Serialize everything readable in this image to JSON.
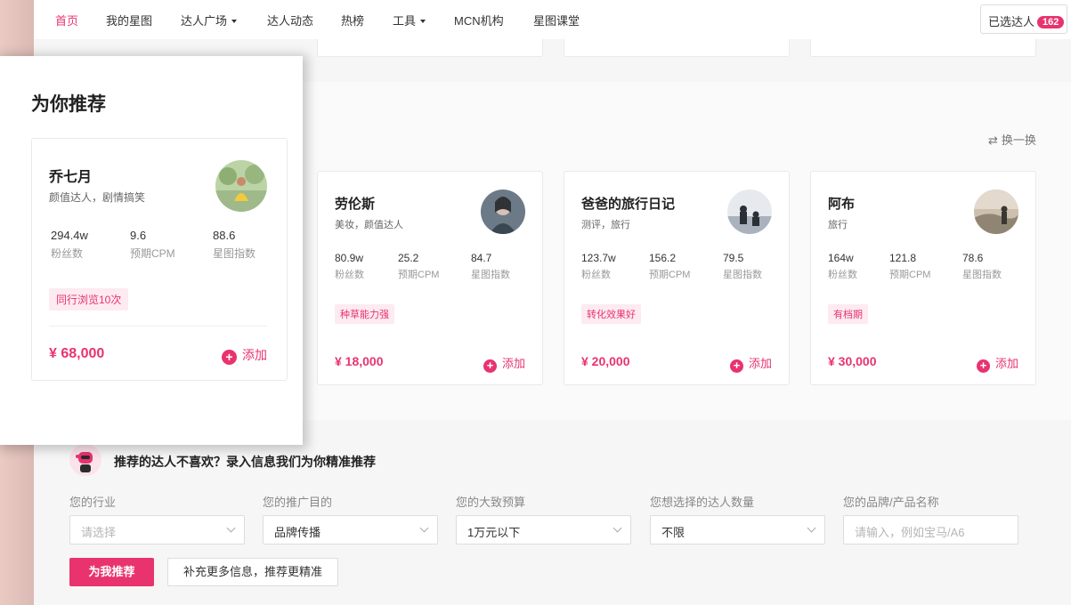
{
  "nav": {
    "items": [
      {
        "label": "首页",
        "active": true,
        "dropdown": false
      },
      {
        "label": "我的星图",
        "active": false,
        "dropdown": false
      },
      {
        "label": "达人广场",
        "active": false,
        "dropdown": true
      },
      {
        "label": "达人动态",
        "active": false,
        "dropdown": false
      },
      {
        "label": "热榜",
        "active": false,
        "dropdown": false
      },
      {
        "label": "工具",
        "active": false,
        "dropdown": true
      },
      {
        "label": "MCN机构",
        "active": false,
        "dropdown": false
      },
      {
        "label": "星图课堂",
        "active": false,
        "dropdown": false
      }
    ],
    "selected_label": "已选达人",
    "selected_count": "162"
  },
  "recommend": {
    "title": "为你推荐",
    "swap_label": "换一换",
    "add_label": "添加",
    "stat_labels": {
      "fans": "粉丝数",
      "cpm": "预期CPM",
      "index": "星图指数"
    },
    "cards": [
      {
        "name": "乔七月",
        "tags": "颜值达人，剧情搞笑",
        "fans": "294.4w",
        "cpm": "9.6",
        "index": "88.6",
        "badge": "同行浏览10次",
        "price": "¥ 68,000",
        "avatar": "girl-in-yellow-dress"
      },
      {
        "name": "劳伦斯",
        "tags": "美妆，颜值达人",
        "fans": "80.9w",
        "cpm": "25.2",
        "index": "84.7",
        "badge": "种草能力强",
        "price": "¥ 18,000",
        "avatar": "person-dark-portrait"
      },
      {
        "name": "爸爸的旅行日记",
        "tags": "测评，旅行",
        "fans": "123.7w",
        "cpm": "156.2",
        "index": "79.5",
        "badge": "转化效果好",
        "price": "¥ 20,000",
        "avatar": "silhouette-travelers"
      },
      {
        "name": "阿布",
        "tags": "旅行",
        "fans": "164w",
        "cpm": "121.8",
        "index": "78.6",
        "badge": "有档期",
        "price": "¥ 30,000",
        "avatar": "person-sunset-landscape"
      }
    ]
  },
  "form": {
    "hint": "推荐的达人不喜欢？录入信息我们为你精准推荐",
    "fields": [
      {
        "label": "您的行业",
        "value": "",
        "placeholder": "请选择",
        "type": "select"
      },
      {
        "label": "您的推广目的",
        "value": "品牌传播",
        "placeholder": "",
        "type": "select"
      },
      {
        "label": "您的大致预算",
        "value": "1万元以下",
        "placeholder": "",
        "type": "select"
      },
      {
        "label": "您想选择的达人数量",
        "value": "不限",
        "placeholder": "",
        "type": "select"
      },
      {
        "label": "您的品牌/产品名称",
        "value": "",
        "placeholder": "请输入，例如宝马/A6",
        "type": "input"
      }
    ],
    "primary_button": "为我推荐",
    "secondary_button": "补充更多信息，推荐更精准"
  },
  "colors": {
    "accent": "#e8336e",
    "tag_bg": "#fdebf1"
  }
}
